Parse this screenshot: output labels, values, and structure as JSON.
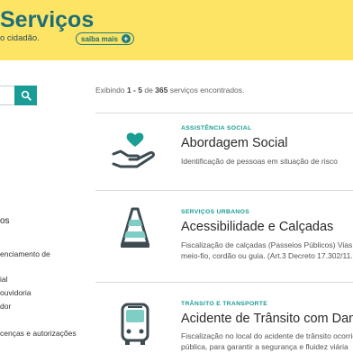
{
  "hero": {
    "title": "Serviços",
    "subtitle": "o cidadão.",
    "more_label": "saiba mais",
    "more_icon": "plus-icon"
  },
  "search": {
    "value": "",
    "icon": "search-icon"
  },
  "sidebar": {
    "heading": "os",
    "items": [
      "enciamento de",
      "ial",
      "ouvidoria",
      "dor",
      "cenças e autorizações"
    ]
  },
  "results": {
    "prefix": "Exibindo ",
    "range": "1 - 5",
    "middle": " de ",
    "total": "365",
    "suffix": " serviços encontrados."
  },
  "services": [
    {
      "category": "ASSISTÊNCIA SOCIAL",
      "title": "Abordagem Social",
      "description_lines": [
        "Identificação de pessoas em situação de risco"
      ],
      "icon": "hand-heart-icon"
    },
    {
      "category": "SERVIÇOS URBANOS",
      "title": "Acessibilidade e Calçadas",
      "description_lines": [
        "Fiscalização de calçadas (Passeios Públicos) Vias que",
        "meio-fio, cordão ou guia. (Art.3 Decreto 17.302/11.)"
      ],
      "icon": "traffic-cone-icon"
    },
    {
      "category": "TRÂNSITO E TRANSPORTE",
      "title": "Acidente de Trânsito com Danos",
      "description_lines": [
        "Fiscalização no local do acidente de trânsito ocorrid",
        "pública, para garantir a segurança e fluidez viária"
      ],
      "icon": "bus-icon"
    }
  ],
  "colors": {
    "hero_bg": "#fde464",
    "accent": "#199c96",
    "title": "#1d6e78"
  }
}
